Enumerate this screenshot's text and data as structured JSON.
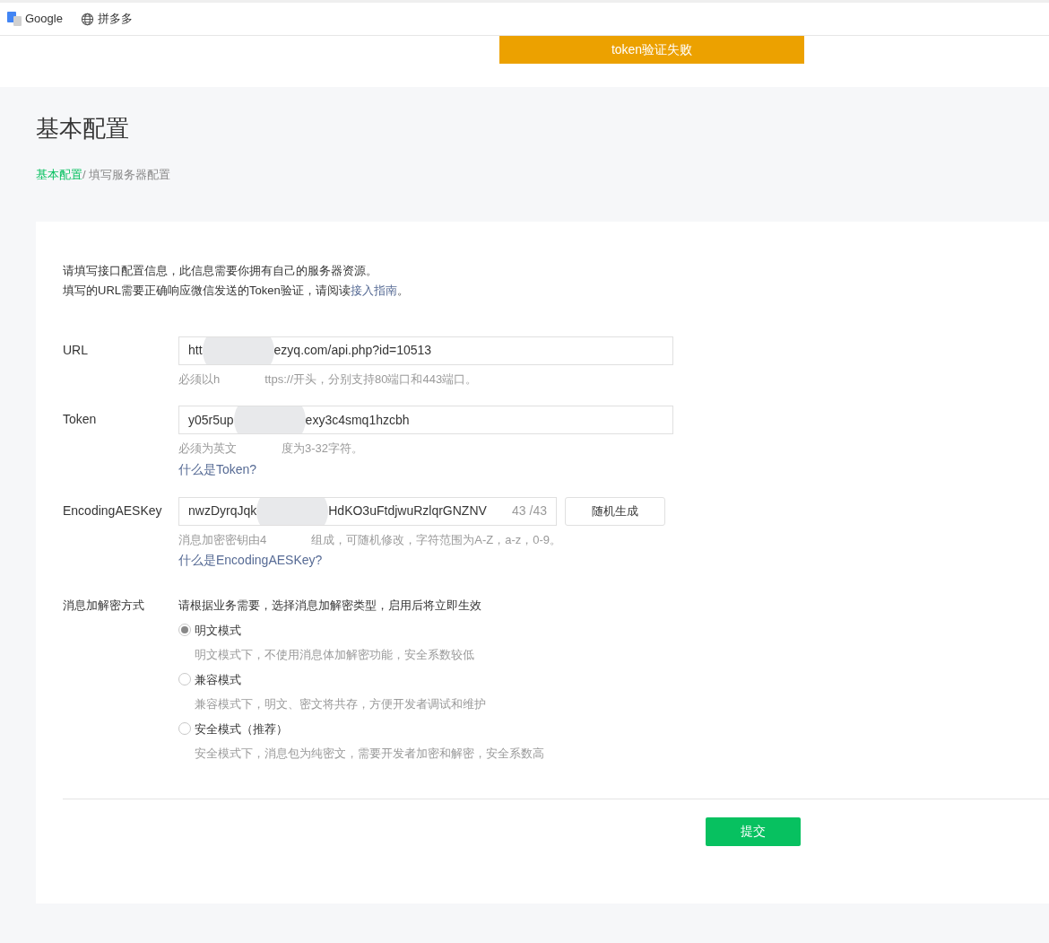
{
  "bookmarks": [
    {
      "kind": "google",
      "label": "Google"
    },
    {
      "kind": "globe",
      "label": "拼多多"
    }
  ],
  "toast": "token验证失败",
  "title": "基本配置",
  "breadcrumb": {
    "link": "基本配置",
    "rest": "/ 填写服务器配置"
  },
  "intro": {
    "line1": "请填写接口配置信息，此信息需要你拥有自己的服务器资源。",
    "line2": "填写的URL需要正确响应微信发送的Token验证，请阅读",
    "link": "接入指南",
    "end": "。"
  },
  "fields": [
    {
      "label": "URL",
      "value_parts": [
        "htt",
        "ezyq.com/api.php?id=10513"
      ],
      "hint_parts": [
        "必须以h",
        "ttps://开头，分别支持80端口和443端口。"
      ]
    },
    {
      "label": "Token",
      "value_parts": [
        "y05r5up",
        "exy3c4smq1hzcbh"
      ],
      "hint_parts": [
        "必须为英文",
        "度为3-32字符。"
      ],
      "help_link": "什么是Token?"
    },
    {
      "label": "EncodingAESKey",
      "value_parts": [
        "nwzDyrqJqk",
        "HdKO3uFtdjwuRzlqrGNZNV"
      ],
      "counter": "43 /43",
      "button": "随机生成",
      "hint_parts": [
        "消息加密密钥由4",
        "组成，可随机修改，字符范围为A-Z，a-z，0-9。"
      ],
      "help_link": "什么是EncodingAESKey?"
    }
  ],
  "encryption": {
    "label": "消息加解密方式",
    "description": "请根据业务需要，选择消息加解密类型，启用后将立即生效",
    "options": [
      {
        "label": "明文模式",
        "note": "明文模式下，不使用消息体加解密功能，安全系数较低",
        "selected": true
      },
      {
        "label": "兼容模式",
        "note": "兼容模式下，明文、密文将共存，方便开发者调试和维护",
        "selected": false
      },
      {
        "label": "安全模式（推荐）",
        "note": "安全模式下，消息包为纯密文，需要开发者加密和解密，安全系数高",
        "selected": false
      }
    ]
  },
  "submit": "提交"
}
